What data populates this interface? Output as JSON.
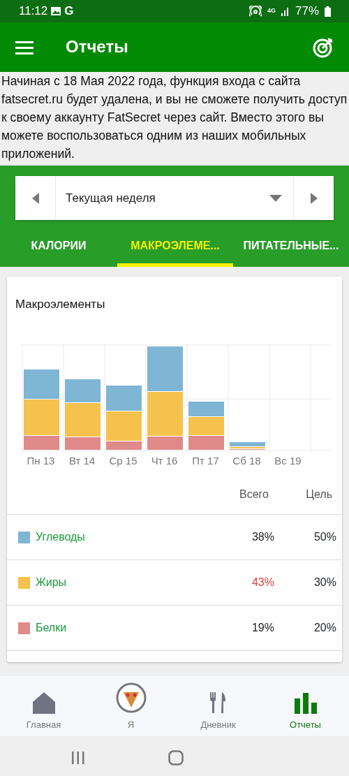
{
  "status_bar": {
    "time": "11:12",
    "carrier": "G",
    "network": "4G",
    "battery": "77%"
  },
  "app_bar": {
    "title": "Отчеты"
  },
  "notice": "Начиная с 18 Мая 2022 года, функция входа с сайта fatsecret.ru будет удалена, и вы не сможете получить доступ к своему аккаунту FatSecret через сайт. Вместо этого вы можете воспользоваться одним из наших мобильных приложений.",
  "period": {
    "value": "Текущая неделя"
  },
  "tabs": [
    {
      "label": "КАЛОРИИ",
      "selected": false
    },
    {
      "label": "МАКРОЭЛЕМЕ...",
      "selected": true
    },
    {
      "label": "ПИТАТЕЛЬНЫЕ...",
      "selected": false
    }
  ],
  "card": {
    "title": "Макроэлементы",
    "days": [
      "Пн 13",
      "Вт 14",
      "Ср 15",
      "Чт 16",
      "Пт 17",
      "Сб 18",
      "Вс 19"
    ],
    "columns": [
      "Всего",
      "Цель"
    ],
    "macros": [
      {
        "name": "Углеводы",
        "color": "#7fb5d5",
        "total": "38%",
        "goal": "50%",
        "over": false
      },
      {
        "name": "Жиры",
        "color": "#f4c24d",
        "total": "43%",
        "goal": "30%",
        "over": true
      },
      {
        "name": "Белки",
        "color": "#e08a8a",
        "total": "19%",
        "goal": "20%",
        "over": false
      }
    ]
  },
  "bottom_nav": [
    {
      "label": "Главная",
      "kind": "home",
      "selected": false
    },
    {
      "label": "Я",
      "kind": "avatar",
      "selected": false
    },
    {
      "label": "Дневник",
      "kind": "diary",
      "selected": false
    },
    {
      "label": "Отчеты",
      "kind": "reports",
      "selected": true
    }
  ]
}
